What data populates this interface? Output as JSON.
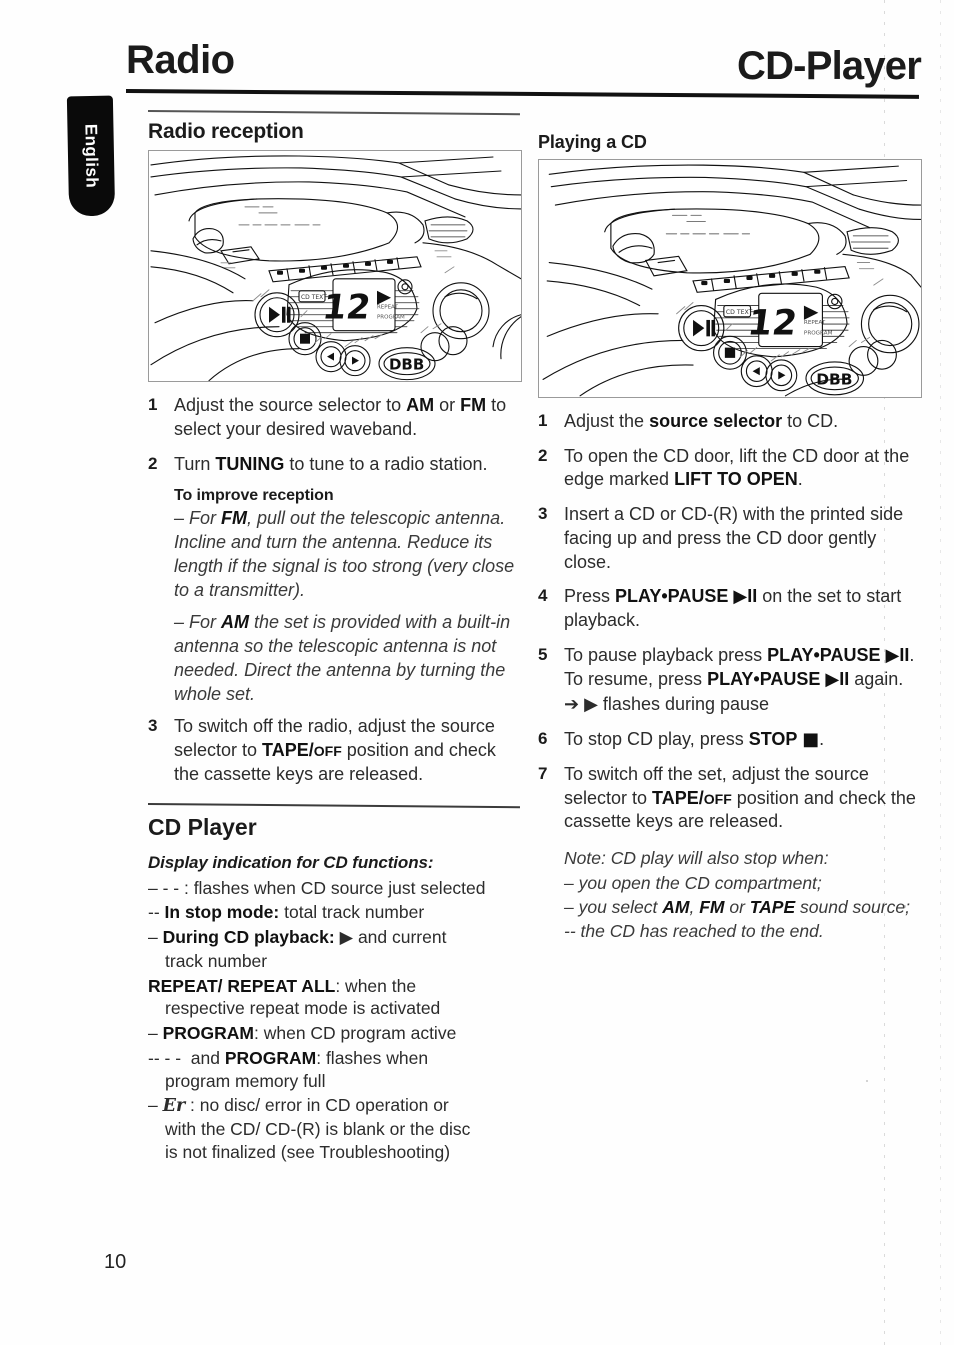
{
  "page": {
    "number": "10",
    "language_tab": "English",
    "header_left": "Radio",
    "header_right": "CD-Player"
  },
  "left_column": {
    "section_title": "Radio reception",
    "illustration_name": "boombox-control-panel-illustration",
    "steps": [
      {
        "num": "1",
        "parts": [
          {
            "t": "Adjust the source selector to ",
            "b": false
          },
          {
            "t": "AM",
            "b": true
          },
          {
            "t": " or ",
            "b": false
          },
          {
            "t": "FM",
            "b": true
          },
          {
            "t": " to select your desired waveband.",
            "b": false
          }
        ]
      },
      {
        "num": "2",
        "parts": [
          {
            "t": "Turn ",
            "b": false
          },
          {
            "t": "TUNING",
            "b": true
          },
          {
            "t": " to tune to a radio station.",
            "b": false
          }
        ]
      }
    ],
    "improve_heading": "To improve reception",
    "improve_paras": [
      [
        {
          "t": "– For ",
          "b": false,
          "i": true
        },
        {
          "t": "FM",
          "b": true,
          "i": false
        },
        {
          "t": ", pull out the telescopic antenna. Incline and turn the antenna. Reduce its length if the signal is too strong (very close to a transmitter).",
          "b": false,
          "i": true
        }
      ],
      [
        {
          "t": "– For ",
          "b": false,
          "i": true
        },
        {
          "t": "AM",
          "b": true,
          "i": false
        },
        {
          "t": " the set is provided with a built-in antenna so the telescopic antenna is not needed. Direct the antenna by turning the whole set.",
          "b": false,
          "i": true
        }
      ]
    ],
    "step3": {
      "num": "3",
      "parts": [
        {
          "t": "To switch off the radio, adjust the source selector to ",
          "b": false
        },
        {
          "t": "TAPE/",
          "b": true
        },
        {
          "t": "OFF",
          "b": true,
          "sc": true
        },
        {
          "t": " position and check the cassette keys are released.",
          "b": false
        }
      ]
    },
    "cd_player_title": "CD Player",
    "display_heading": "Display indication for CD functions:",
    "display_items": [
      {
        "lead": "– - - :",
        "parts": [
          {
            "t": " flashes when CD source just selected",
            "b": false
          }
        ]
      },
      {
        "lead": "--",
        "parts": [
          {
            "t": " In stop mode:",
            "b": true
          },
          {
            "t": " total track number",
            "b": false
          }
        ]
      },
      {
        "lead": "–",
        "parts": [
          {
            "t": " During CD playback:",
            "b": true
          },
          {
            "t": " ▶ and current track number",
            "b": false
          }
        ]
      },
      {
        "lead": "",
        "parts": [
          {
            "t": "REPEAT/ REPEAT ALL",
            "b": true
          },
          {
            "t": ": when the respective repeat mode is activated",
            "b": false
          }
        ]
      },
      {
        "lead": "–",
        "parts": [
          {
            "t": " PROGRAM",
            "b": true
          },
          {
            "t": ": when CD program active",
            "b": false
          }
        ]
      },
      {
        "lead": "-- - -",
        "parts": [
          {
            "t": " and ",
            "b": false
          },
          {
            "t": "PROGRAM",
            "b": true
          },
          {
            "t": ": flashes when program memory full",
            "b": false
          }
        ]
      },
      {
        "lead": "–",
        "parts": [
          {
            "t": " Er",
            "b": false,
            "disp": true
          },
          {
            "t": " : no disc/ error in CD operation or with the CD/ CD-(R) is blank or the disc is not finalized (see Troubleshooting)",
            "b": false
          }
        ]
      }
    ]
  },
  "right_column": {
    "section_title": "Playing a CD",
    "illustration_name": "boombox-control-panel-illustration",
    "steps": [
      {
        "num": "1",
        "parts": [
          {
            "t": "Adjust the ",
            "b": false
          },
          {
            "t": "source selector",
            "b": true
          },
          {
            "t": " to CD.",
            "b": false
          }
        ]
      },
      {
        "num": "2",
        "parts": [
          {
            "t": "To open the CD door, lift the CD door at the edge marked ",
            "b": false
          },
          {
            "t": "LIFT TO OPEN",
            "b": true
          },
          {
            "t": ".",
            "b": false
          }
        ]
      },
      {
        "num": "3",
        "parts": [
          {
            "t": "Insert a CD or CD-(R) with the printed side facing up and press the CD door gently close.",
            "b": false
          }
        ]
      },
      {
        "num": "4",
        "parts": [
          {
            "t": "Press ",
            "b": false
          },
          {
            "t": "PLAY•PAUSE ▶II",
            "b": true
          },
          {
            "t": " on the set to start playback.",
            "b": false
          }
        ]
      },
      {
        "num": "5",
        "parts": [
          {
            "t": "To pause playback press ",
            "b": false
          },
          {
            "t": "PLAY•PAUSE ▶II",
            "b": true
          },
          {
            "t": ". To resume, press ",
            "b": false
          },
          {
            "t": "PLAY•PAUSE ▶II",
            "b": true
          },
          {
            "t": " again.",
            "b": false
          }
        ],
        "sub": "➔ ▶ flashes during pause"
      },
      {
        "num": "6",
        "parts": [
          {
            "t": "To stop CD play, press ",
            "b": false
          },
          {
            "t": "STOP ■",
            "b": true
          },
          {
            "t": ".",
            "b": false
          }
        ]
      },
      {
        "num": "7",
        "parts": [
          {
            "t": "To switch off the set, adjust the source selector to ",
            "b": false
          },
          {
            "t": "TAPE/",
            "b": true
          },
          {
            "t": "OFF",
            "b": true,
            "sc": true
          },
          {
            "t": " position and check the cassette keys are released.",
            "b": false
          }
        ]
      }
    ],
    "note_lines": [
      [
        {
          "t": "Note: CD play will also stop when:",
          "b": false,
          "i": true
        }
      ],
      [
        {
          "t": "– you open the CD compartment;",
          "b": false,
          "i": true
        }
      ],
      [
        {
          "t": "– you select ",
          "b": false,
          "i": true
        },
        {
          "t": "AM",
          "b": true,
          "i": false
        },
        {
          "t": ", ",
          "b": false,
          "i": true
        },
        {
          "t": "FM",
          "b": true,
          "i": false
        },
        {
          "t": " or ",
          "b": false,
          "i": true
        },
        {
          "t": "TAPE",
          "b": true,
          "i": false
        },
        {
          "t": " sound source;",
          "b": false,
          "i": true
        }
      ],
      [
        {
          "t": "-- the CD has reached to the end.",
          "b": false,
          "i": true
        }
      ]
    ]
  },
  "illustration_labels": {
    "display_value": "12",
    "dbb_button": "DBB",
    "play_pause": "▶II",
    "stop": "■",
    "search_back": "❘◀◀",
    "search_fwd": "▶▶❘"
  }
}
